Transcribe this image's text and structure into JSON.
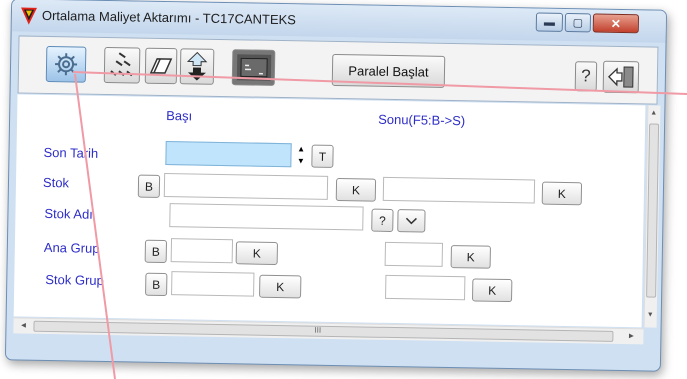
{
  "window": {
    "title": "Ortalama Maliyet Aktarımı - TC17CANTEKS"
  },
  "toolbar": {
    "paralel_label": "Paralel Başlat",
    "help_label": "?"
  },
  "header": {
    "start": "Başı",
    "end": "Sonu(F5:B->S)"
  },
  "labels": {
    "son_tarih": "Son Tarih",
    "stok": "Stok",
    "stok_adi": "Stok Adı",
    "ana_grup": "Ana Grup",
    "stok_grup": "Stok Grup"
  },
  "buttons": {
    "b": "B",
    "k": "K",
    "t": "T",
    "q": "?"
  },
  "scroll": {
    "grip": "III",
    "up": "▲",
    "down": "▼",
    "left": "◄",
    "right": "►"
  },
  "colors": {
    "label": "#2d2dc8",
    "highlight_input": "#bfe4fb",
    "frame": "#cfe0f2",
    "close": "#c2412e"
  }
}
